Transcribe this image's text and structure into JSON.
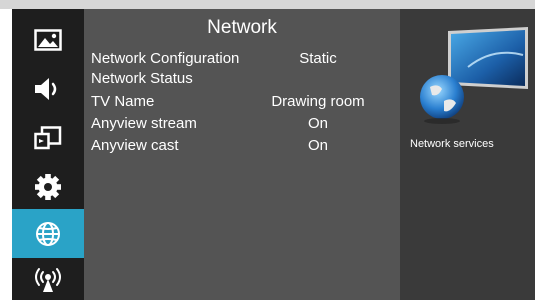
{
  "menu": {
    "title": "Network",
    "items": [
      {
        "label": "Network Configuration",
        "value": "Static"
      },
      {
        "label": "Network Status",
        "value": ""
      },
      {
        "label": "TV Name",
        "value": "Drawing room"
      },
      {
        "label": "Anyview stream",
        "value": "On"
      },
      {
        "label": "Anyview cast",
        "value": "On"
      }
    ]
  },
  "sidebar": {
    "items": [
      {
        "icon": "picture-icon"
      },
      {
        "icon": "sound-icon"
      },
      {
        "icon": "input-source-icon"
      },
      {
        "icon": "settings-gear-icon"
      },
      {
        "icon": "globe-icon",
        "active": true
      },
      {
        "icon": "wireless-icon"
      }
    ]
  },
  "right_panel": {
    "label": "Network services"
  },
  "colors": {
    "accent": "#2aa3c7",
    "sidebar_bg": "#1e1e1e",
    "menu_bg": "#545454",
    "panel_bg": "#3a3a3a"
  }
}
